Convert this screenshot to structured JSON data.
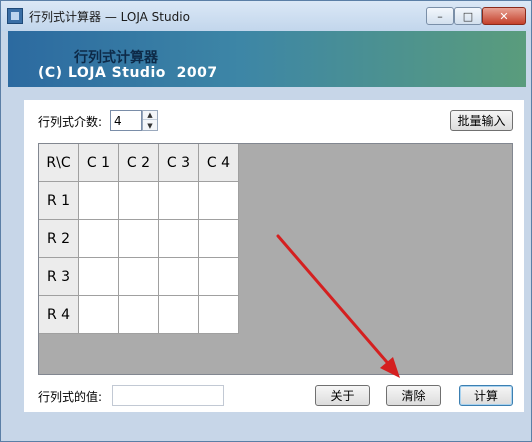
{
  "window": {
    "title": "行列式计算器 — LOJA Studio",
    "minimize_glyph": "–",
    "maximize_glyph": "□",
    "close_glyph": "✕"
  },
  "banner": {
    "title": "行列式计算器",
    "copyright": "(C) LOJA Studio  2007"
  },
  "order": {
    "label": "行列式介数:",
    "value": "4",
    "spin_up": "▲",
    "spin_down": "▼"
  },
  "buttons": {
    "batch_input": "批量输入",
    "about": "关于",
    "clear": "清除",
    "compute": "计算"
  },
  "grid": {
    "corner": "R\\C",
    "columns": [
      "C 1",
      "C 2",
      "C 3",
      "C 4"
    ],
    "rows": [
      "R 1",
      "R 2",
      "R 3",
      "R 4"
    ]
  },
  "result": {
    "label": "行列式的值:",
    "value": ""
  },
  "colors": {
    "annotation_arrow": "#d42020",
    "banner_start": "#2c6aa0",
    "banner_end": "#5a9c7c"
  }
}
